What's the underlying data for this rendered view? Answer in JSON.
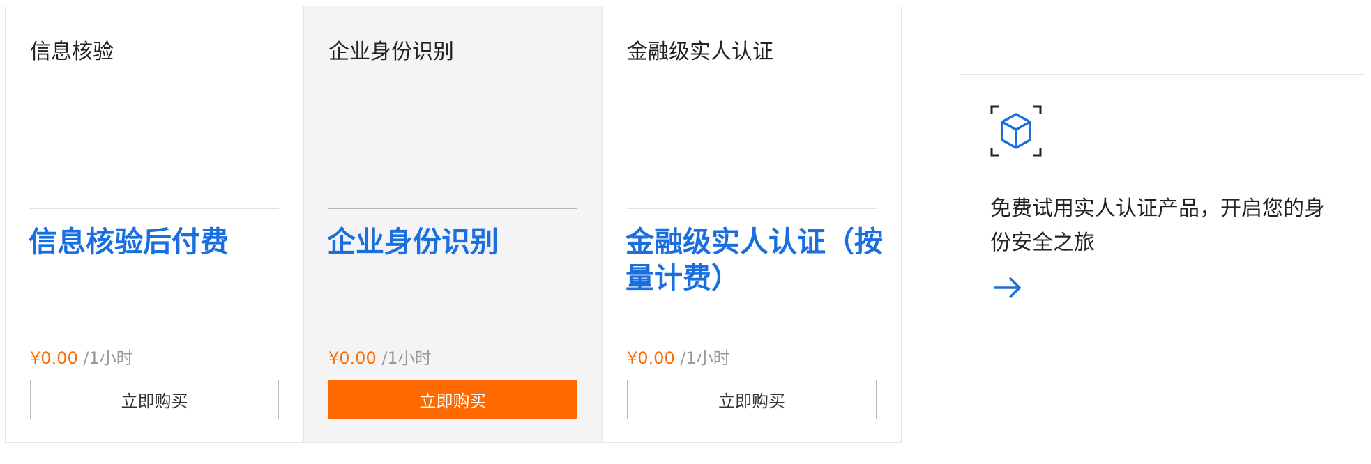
{
  "products": [
    {
      "title": "信息核验",
      "headline": "信息核验后付费",
      "price": "¥0.00",
      "unit": " /1小时",
      "button_label": "立即购买"
    },
    {
      "title": "企业身份识别",
      "headline": "企业身份识别",
      "price": "¥0.00",
      "unit": " /1小时",
      "button_label": "立即购买"
    },
    {
      "title": "金融级实人认证",
      "headline": "金融级实人认证（按量计费）",
      "price": "¥0.00",
      "unit": " /1小时",
      "button_label": "立即购买"
    }
  ],
  "promo": {
    "icon": "cube-scan-icon",
    "text": "免费试用实人认证产品，开启您的身份安全之旅",
    "arrow_icon": "arrow-right-icon"
  },
  "colors": {
    "accent_blue": "#1a6fe0",
    "accent_orange": "#ff6a00",
    "active_card_bg": "#f4f4f4"
  }
}
